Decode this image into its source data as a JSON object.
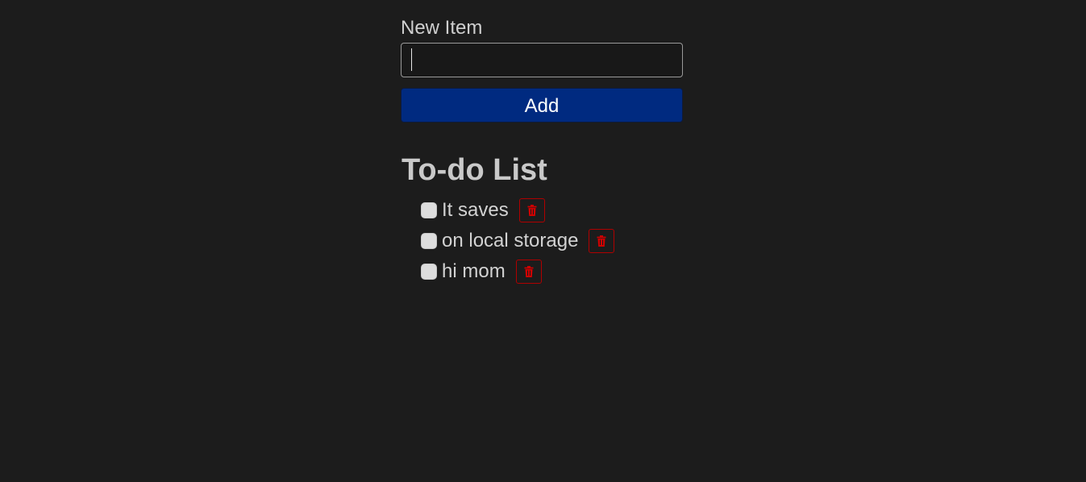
{
  "form": {
    "label": "New Item",
    "input_value": "",
    "add_label": "Add"
  },
  "todo": {
    "title": "To-do List",
    "items": [
      {
        "text": "It saves",
        "checked": false
      },
      {
        "text": "on local storage",
        "checked": false
      },
      {
        "text": "hi mom",
        "checked": false
      }
    ]
  },
  "colors": {
    "background": "#1c1c1c",
    "accent": "#002a80",
    "danger": "#d00000"
  },
  "icons": {
    "delete": "trash-icon"
  }
}
